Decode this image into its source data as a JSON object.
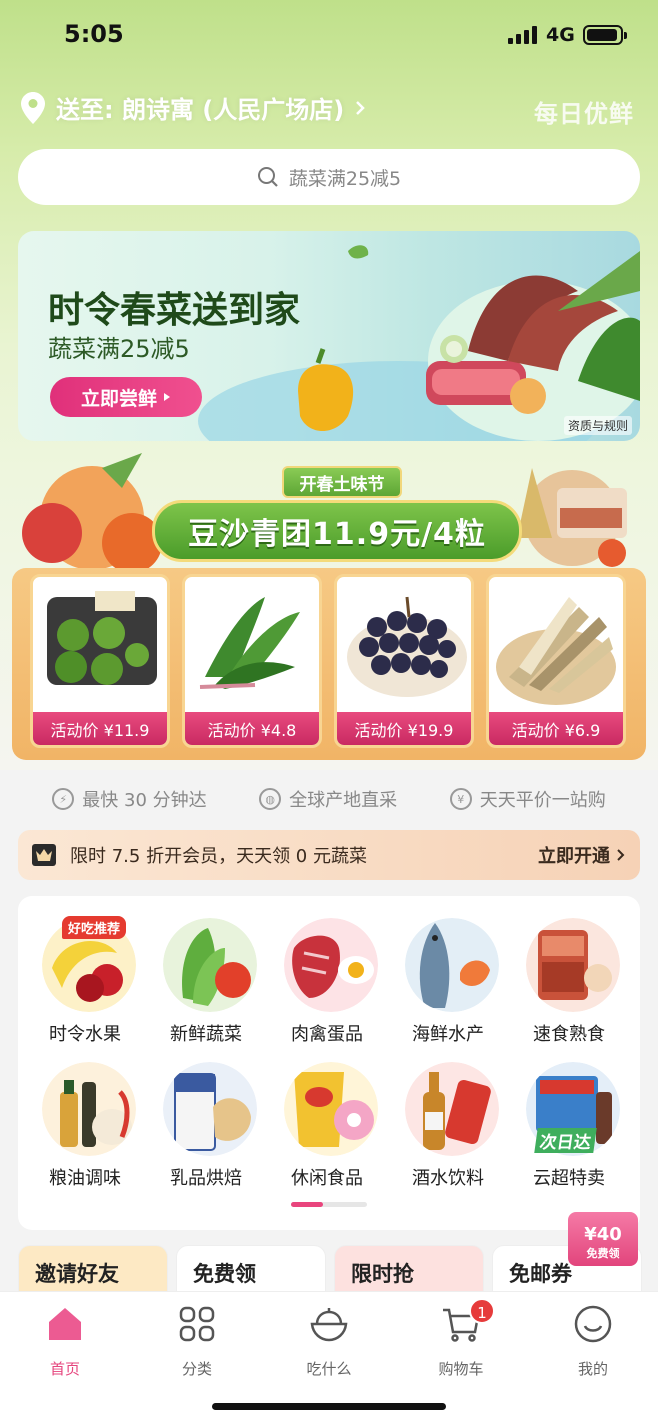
{
  "status": {
    "time": "5:05",
    "network": "4G"
  },
  "header": {
    "delivery_label": "送至: 朗诗寓 (人民广场店)",
    "brand": "每日优鲜"
  },
  "search": {
    "placeholder": "蔬菜满25减5"
  },
  "banner": {
    "title": "时令春菜送到家",
    "subtitle": "蔬菜满25减5",
    "cta": "立即尝鲜",
    "rules": "资质与规则"
  },
  "promo": {
    "tag": "开春土味节",
    "headline": "豆沙青团11.9元/4粒",
    "items": [
      {
        "name": "qingtuan",
        "price": "活动价 ¥11.9"
      },
      {
        "name": "spinach",
        "price": "活动价 ¥4.8"
      },
      {
        "name": "grapes",
        "price": "活动价 ¥19.9"
      },
      {
        "name": "bamboo-shoots",
        "price": "活动价 ¥6.9"
      }
    ]
  },
  "features": [
    "最快 30 分钟达",
    "全球产地直采",
    "天天平价一站购"
  ],
  "member": {
    "text": "限时 7.5 折开会员，天天领 0 元蔬菜",
    "cta": "立即开通"
  },
  "categories": [
    {
      "label": "时令水果",
      "badge": "好吃推荐",
      "color": "#f4d23a"
    },
    {
      "label": "新鲜蔬菜",
      "color": "#5fae3e"
    },
    {
      "label": "肉禽蛋品",
      "color": "#c8323c"
    },
    {
      "label": "海鲜水产",
      "color": "#4a6e8a"
    },
    {
      "label": "速食熟食",
      "color": "#c9523a"
    },
    {
      "label": "粮油调味",
      "color": "#d9a33a"
    },
    {
      "label": "乳品烘焙",
      "color": "#e6c48a"
    },
    {
      "label": "休闲食品",
      "color": "#f2c230"
    },
    {
      "label": "酒水饮料",
      "color": "#d7392f"
    },
    {
      "label": "云超特卖",
      "badge": "次日达",
      "color": "#3a7fc9"
    }
  ],
  "strips": [
    {
      "label": "邀请好友",
      "bg": "#fde9c4"
    },
    {
      "label": "免费领",
      "bg": "#ffffff"
    },
    {
      "label": "限时抢",
      "bg": "#fde1df"
    },
    {
      "label": "免邮券",
      "bg": "#ffffff"
    }
  ],
  "gift": {
    "amount": "¥40",
    "label": "免费领"
  },
  "tabs": [
    {
      "label": "首页",
      "icon": "home-icon"
    },
    {
      "label": "分类",
      "icon": "grid-icon"
    },
    {
      "label": "吃什么",
      "icon": "bowl-icon"
    },
    {
      "label": "购物车",
      "icon": "cart-icon",
      "badge": "1"
    },
    {
      "label": "我的",
      "icon": "smile-icon"
    }
  ],
  "colors": {
    "accent": "#e6457e",
    "brand_green": "#4b9c2a"
  }
}
